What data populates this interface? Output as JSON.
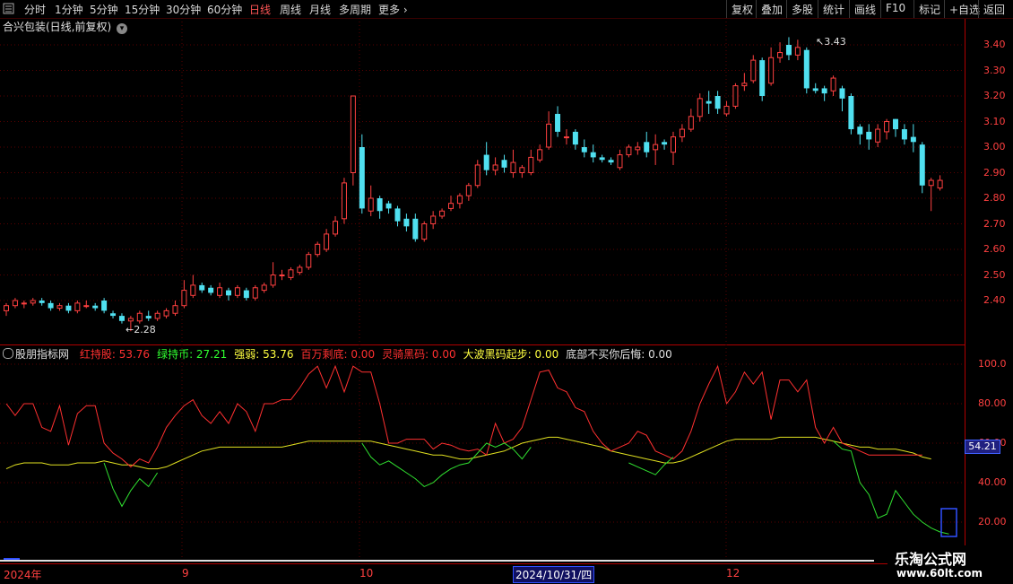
{
  "toolbar": {
    "periods": [
      {
        "label": "分时",
        "x": 27
      },
      {
        "label": "1分钟",
        "x": 61
      },
      {
        "label": "5分钟",
        "x": 100
      },
      {
        "label": "15分钟",
        "x": 139
      },
      {
        "label": "30分钟",
        "x": 185
      },
      {
        "label": "60分钟",
        "x": 231
      },
      {
        "label": "日线",
        "x": 278,
        "active": true
      },
      {
        "label": "周线",
        "x": 312
      },
      {
        "label": "月线",
        "x": 345
      },
      {
        "label": "多周期",
        "x": 378
      },
      {
        "label": "更多",
        "x": 422
      }
    ],
    "right_buttons": [
      {
        "label": "复权",
        "x": 810
      },
      {
        "label": "叠加",
        "x": 843
      },
      {
        "label": "多股",
        "x": 877
      },
      {
        "label": "统计",
        "x": 912
      },
      {
        "label": "画线",
        "x": 947
      },
      {
        "label": "F10",
        "x": 982
      },
      {
        "label": "标记",
        "x": 1019
      },
      {
        "label": "+自选",
        "x": 1053
      },
      {
        "label": "返回",
        "x": 1091
      }
    ]
  },
  "stock_title": "合兴包装(日线,前复权)",
  "price_axis": [
    "3.40",
    "3.30",
    "3.20",
    "3.10",
    "3.00",
    "2.90",
    "2.80",
    "2.70",
    "2.60",
    "2.50",
    "2.40"
  ],
  "max_label": "3.43",
  "min_label": "2.28",
  "indicator": {
    "name": "股朋指标网",
    "items": [
      {
        "label": "红持股: 53.76",
        "color": "#ff3030"
      },
      {
        "label": "绿持币: 27.21",
        "color": "#30ff30"
      },
      {
        "label": "强弱: 53.76",
        "color": "#ffff40"
      },
      {
        "label": "百万剩底: 0.00",
        "color": "#ff3030"
      },
      {
        "label": "灵骑黑码: 0.00",
        "color": "#ff3030"
      },
      {
        "label": "大波黑码起步: 0.00",
        "color": "#ffff40"
      },
      {
        "label": "底部不买你后悔: 0.00",
        "color": "#e0e0e0"
      }
    ],
    "axis": [
      "100.0",
      "80.00",
      "60.00",
      "40.00",
      "20.00"
    ],
    "current_value": "54.21"
  },
  "dates": [
    {
      "label": "2024年",
      "x": 4
    },
    {
      "label": "9",
      "x": 203
    },
    {
      "label": "10",
      "x": 401
    },
    {
      "label": "12",
      "x": 810
    }
  ],
  "cursor_date": "2024/10/31/四",
  "watermark": {
    "line1": "乐淘公式网",
    "line2": "www.60lt.com"
  },
  "chart_data": {
    "type": "candlestick",
    "ylim": [
      2.3,
      3.45
    ],
    "candles": [
      [
        2.36,
        2.38,
        2.34,
        2.39
      ],
      [
        2.38,
        2.4,
        2.37,
        2.41
      ],
      [
        2.39,
        2.39,
        2.37,
        2.4
      ],
      [
        2.39,
        2.4,
        2.38,
        2.41
      ],
      [
        2.4,
        2.39,
        2.38,
        2.41
      ],
      [
        2.39,
        2.37,
        2.36,
        2.4
      ],
      [
        2.37,
        2.38,
        2.36,
        2.39
      ],
      [
        2.38,
        2.36,
        2.35,
        2.39
      ],
      [
        2.36,
        2.39,
        2.35,
        2.4
      ],
      [
        2.38,
        2.38,
        2.37,
        2.4
      ],
      [
        2.38,
        2.37,
        2.36,
        2.39
      ],
      [
        2.4,
        2.36,
        2.35,
        2.41
      ],
      [
        2.35,
        2.34,
        2.33,
        2.36
      ],
      [
        2.34,
        2.32,
        2.31,
        2.35
      ],
      [
        2.32,
        2.33,
        2.28,
        2.34
      ],
      [
        2.32,
        2.35,
        2.31,
        2.36
      ],
      [
        2.34,
        2.33,
        2.32,
        2.36
      ],
      [
        2.33,
        2.35,
        2.32,
        2.36
      ],
      [
        2.34,
        2.36,
        2.33,
        2.37
      ],
      [
        2.35,
        2.38,
        2.34,
        2.4
      ],
      [
        2.38,
        2.44,
        2.37,
        2.48
      ],
      [
        2.42,
        2.46,
        2.41,
        2.5
      ],
      [
        2.46,
        2.44,
        2.43,
        2.47
      ],
      [
        2.45,
        2.43,
        2.42,
        2.46
      ],
      [
        2.42,
        2.45,
        2.41,
        2.47
      ],
      [
        2.44,
        2.42,
        2.4,
        2.45
      ],
      [
        2.42,
        2.45,
        2.41,
        2.46
      ],
      [
        2.44,
        2.41,
        2.4,
        2.45
      ],
      [
        2.41,
        2.45,
        2.4,
        2.46
      ],
      [
        2.44,
        2.46,
        2.43,
        2.47
      ],
      [
        2.46,
        2.5,
        2.45,
        2.55
      ],
      [
        2.5,
        2.5,
        2.48,
        2.52
      ],
      [
        2.49,
        2.52,
        2.48,
        2.53
      ],
      [
        2.51,
        2.53,
        2.5,
        2.54
      ],
      [
        2.53,
        2.58,
        2.52,
        2.59
      ],
      [
        2.58,
        2.62,
        2.57,
        2.63
      ],
      [
        2.6,
        2.66,
        2.59,
        2.68
      ],
      [
        2.66,
        2.71,
        2.65,
        2.73
      ],
      [
        2.72,
        2.86,
        2.7,
        2.88
      ],
      [
        2.9,
        3.2,
        2.85,
        3.2
      ],
      [
        3.0,
        2.76,
        2.74,
        3.05
      ],
      [
        2.75,
        2.8,
        2.73,
        2.85
      ],
      [
        2.8,
        2.75,
        2.72,
        2.81
      ],
      [
        2.78,
        2.76,
        2.74,
        2.79
      ],
      [
        2.76,
        2.71,
        2.69,
        2.77
      ],
      [
        2.72,
        2.69,
        2.67,
        2.74
      ],
      [
        2.72,
        2.64,
        2.63,
        2.74
      ],
      [
        2.64,
        2.7,
        2.63,
        2.71
      ],
      [
        2.7,
        2.73,
        2.68,
        2.75
      ],
      [
        2.73,
        2.75,
        2.72,
        2.76
      ],
      [
        2.76,
        2.78,
        2.75,
        2.81
      ],
      [
        2.78,
        2.81,
        2.76,
        2.82
      ],
      [
        2.81,
        2.85,
        2.79,
        2.86
      ],
      [
        2.85,
        2.93,
        2.84,
        2.95
      ],
      [
        2.97,
        2.91,
        2.89,
        3.02
      ],
      [
        2.91,
        2.93,
        2.89,
        2.96
      ],
      [
        2.95,
        2.92,
        2.9,
        2.97
      ],
      [
        2.9,
        2.94,
        2.88,
        2.99
      ],
      [
        2.9,
        2.92,
        2.88,
        2.93
      ],
      [
        2.9,
        2.96,
        2.89,
        2.99
      ],
      [
        2.95,
        2.99,
        2.94,
        3.01
      ],
      [
        3.0,
        3.09,
        2.99,
        3.14
      ],
      [
        3.13,
        3.06,
        3.04,
        3.16
      ],
      [
        3.04,
        3.04,
        3.01,
        3.07
      ],
      [
        3.06,
        3.01,
        2.99,
        3.07
      ],
      [
        3.0,
        2.98,
        2.96,
        3.03
      ],
      [
        2.98,
        2.96,
        2.94,
        3.01
      ],
      [
        2.96,
        2.95,
        2.94,
        2.97
      ],
      [
        2.95,
        2.94,
        2.93,
        2.96
      ],
      [
        2.92,
        2.97,
        2.91,
        2.99
      ],
      [
        2.97,
        3.0,
        2.96,
        3.01
      ],
      [
        2.99,
        3.0,
        2.97,
        3.02
      ],
      [
        3.02,
        2.98,
        2.96,
        3.06
      ],
      [
        2.99,
        3.01,
        2.93,
        3.05
      ],
      [
        3.02,
        3.01,
        2.99,
        3.03
      ],
      [
        2.98,
        3.04,
        2.93,
        3.06
      ],
      [
        3.04,
        3.07,
        3.02,
        3.09
      ],
      [
        3.07,
        3.12,
        3.06,
        3.15
      ],
      [
        3.12,
        3.19,
        3.1,
        3.21
      ],
      [
        3.18,
        3.17,
        3.13,
        3.22
      ],
      [
        3.2,
        3.15,
        3.13,
        3.22
      ],
      [
        3.13,
        3.16,
        3.12,
        3.18
      ],
      [
        3.16,
        3.24,
        3.15,
        3.25
      ],
      [
        3.24,
        3.25,
        3.22,
        3.29
      ],
      [
        3.26,
        3.34,
        3.25,
        3.36
      ],
      [
        3.34,
        3.2,
        3.18,
        3.35
      ],
      [
        3.25,
        3.35,
        3.24,
        3.39
      ],
      [
        3.35,
        3.37,
        3.33,
        3.41
      ],
      [
        3.4,
        3.36,
        3.34,
        3.43
      ],
      [
        3.36,
        3.39,
        3.34,
        3.42
      ],
      [
        3.38,
        3.23,
        3.21,
        3.39
      ],
      [
        3.23,
        3.22,
        3.21,
        3.25
      ],
      [
        3.23,
        3.21,
        3.18,
        3.24
      ],
      [
        3.22,
        3.27,
        3.2,
        3.28
      ],
      [
        3.23,
        3.19,
        3.14,
        3.24
      ],
      [
        3.2,
        3.07,
        3.05,
        3.21
      ],
      [
        3.08,
        3.05,
        3.01,
        3.09
      ],
      [
        3.06,
        3.03,
        2.99,
        3.09
      ],
      [
        3.02,
        3.07,
        3.0,
        3.09
      ],
      [
        3.06,
        3.1,
        3.03,
        3.11
      ],
      [
        3.11,
        3.07,
        3.04,
        3.11
      ],
      [
        3.07,
        3.03,
        3.01,
        3.09
      ],
      [
        3.04,
        3.02,
        2.98,
        3.09
      ],
      [
        3.01,
        2.85,
        2.82,
        3.02
      ],
      [
        2.85,
        2.87,
        2.75,
        2.88
      ],
      [
        2.84,
        2.87,
        2.83,
        2.89
      ]
    ],
    "red_line": [
      80,
      74,
      80,
      80,
      68,
      66,
      79,
      59,
      75,
      79,
      79,
      60,
      55,
      52,
      48,
      52,
      50,
      58,
      68,
      74,
      79,
      82,
      74,
      70,
      76,
      70,
      80,
      76,
      66,
      80,
      80,
      82,
      82,
      88,
      95,
      99,
      88,
      99,
      86,
      99,
      96,
      96,
      80,
      60,
      60,
      62,
      62,
      62,
      57,
      60,
      59,
      57,
      56,
      57,
      54,
      70,
      60,
      62,
      68,
      82,
      96,
      97,
      88,
      86,
      78,
      76,
      66,
      60,
      56,
      58,
      60,
      66,
      64,
      56,
      54,
      52,
      56,
      66,
      80,
      90,
      99,
      80,
      86,
      96,
      90,
      96,
      72,
      92,
      92,
      86,
      92,
      68,
      60,
      68,
      60,
      58,
      56,
      54,
      54,
      54,
      54,
      54,
      54,
      54
    ],
    "yellow_line": [
      47,
      49,
      50,
      50,
      50,
      49,
      49,
      49,
      50,
      50,
      50,
      51,
      50,
      49,
      49,
      48,
      47,
      47,
      48,
      50,
      52,
      54,
      56,
      57,
      58,
      58,
      58,
      58,
      58,
      58,
      58,
      58,
      59,
      60,
      61,
      61,
      61,
      61,
      61,
      61,
      61,
      61,
      60,
      59,
      58,
      57,
      56,
      55,
      54,
      54,
      53,
      52,
      52,
      53,
      54,
      55,
      56,
      58,
      60,
      61,
      62,
      63,
      63,
      62,
      61,
      60,
      59,
      58,
      56,
      55,
      54,
      53,
      52,
      51,
      50,
      50,
      51,
      53,
      55,
      57,
      59,
      61,
      62,
      62,
      62,
      62,
      62,
      63,
      63,
      63,
      63,
      63,
      62,
      61,
      60,
      59,
      58,
      58,
      57,
      57,
      57,
      56,
      55,
      53,
      52
    ],
    "green_line": [
      null,
      null,
      null,
      null,
      null,
      null,
      null,
      null,
      null,
      null,
      null,
      50,
      37,
      28,
      36,
      42,
      38,
      45,
      null,
      null,
      null,
      null,
      null,
      null,
      null,
      null,
      null,
      null,
      null,
      null,
      null,
      null,
      null,
      null,
      null,
      null,
      null,
      null,
      null,
      null,
      60,
      53,
      49,
      51,
      48,
      45,
      42,
      38,
      40,
      44,
      47,
      49,
      50,
      55,
      60,
      58,
      60,
      57,
      52,
      58,
      null,
      null,
      null,
      null,
      null,
      null,
      null,
      null,
      null,
      null,
      50,
      48,
      46,
      44,
      49,
      53,
      null,
      null,
      null,
      null,
      null,
      null,
      null,
      null,
      null,
      null,
      null,
      null,
      null,
      null,
      null,
      null,
      null,
      61,
      57,
      56,
      40,
      34,
      22,
      24,
      36,
      30,
      24,
      20,
      17,
      15,
      14
    ]
  }
}
